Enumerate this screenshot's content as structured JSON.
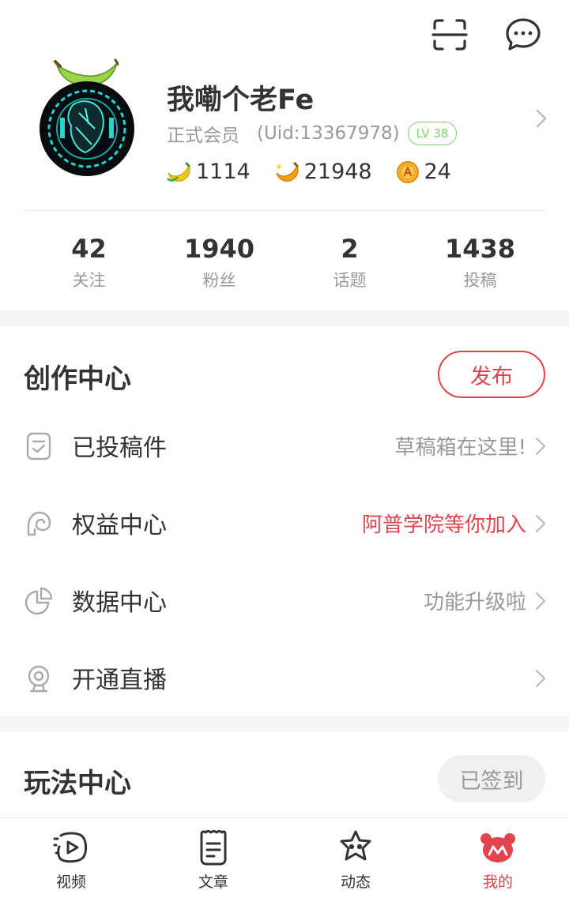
{
  "colors": {
    "accent": "#e2434e",
    "level": "#7ed36b",
    "muted": "#999999"
  },
  "header": {
    "icons": [
      "scan-icon",
      "message-icon"
    ]
  },
  "profile": {
    "username": "我嘞个老Fe",
    "member_type": "正式会员",
    "uid": "(Uid:13367978)",
    "level": "LV 38",
    "bananas": "1114",
    "gold_bananas": "21948",
    "acoins": "24"
  },
  "stats": [
    {
      "value": "42",
      "label": "关注"
    },
    {
      "value": "1940",
      "label": "粉丝"
    },
    {
      "value": "2",
      "label": "话题"
    },
    {
      "value": "1438",
      "label": "投稿"
    }
  ],
  "creation": {
    "title": "创作中心",
    "publish_label": "发布",
    "items": [
      {
        "label": "已投稿件",
        "hint": "草稿箱在这里!",
        "icon": "document-check-icon"
      },
      {
        "label": "权益中心",
        "hint": "阿普学院等你加入",
        "icon": "rights-icon"
      },
      {
        "label": "数据中心",
        "hint": "功能升级啦",
        "icon": "pie-chart-icon"
      },
      {
        "label": "开通直播",
        "hint": "",
        "icon": "camera-icon"
      }
    ]
  },
  "play": {
    "title": "玩法中心",
    "signed_label": "已签到"
  },
  "tabbar": [
    {
      "label": "视频",
      "icon": "video-icon"
    },
    {
      "label": "文章",
      "icon": "article-icon"
    },
    {
      "label": "动态",
      "icon": "feed-icon"
    },
    {
      "label": "我的",
      "icon": "me-icon",
      "active": true
    }
  ]
}
